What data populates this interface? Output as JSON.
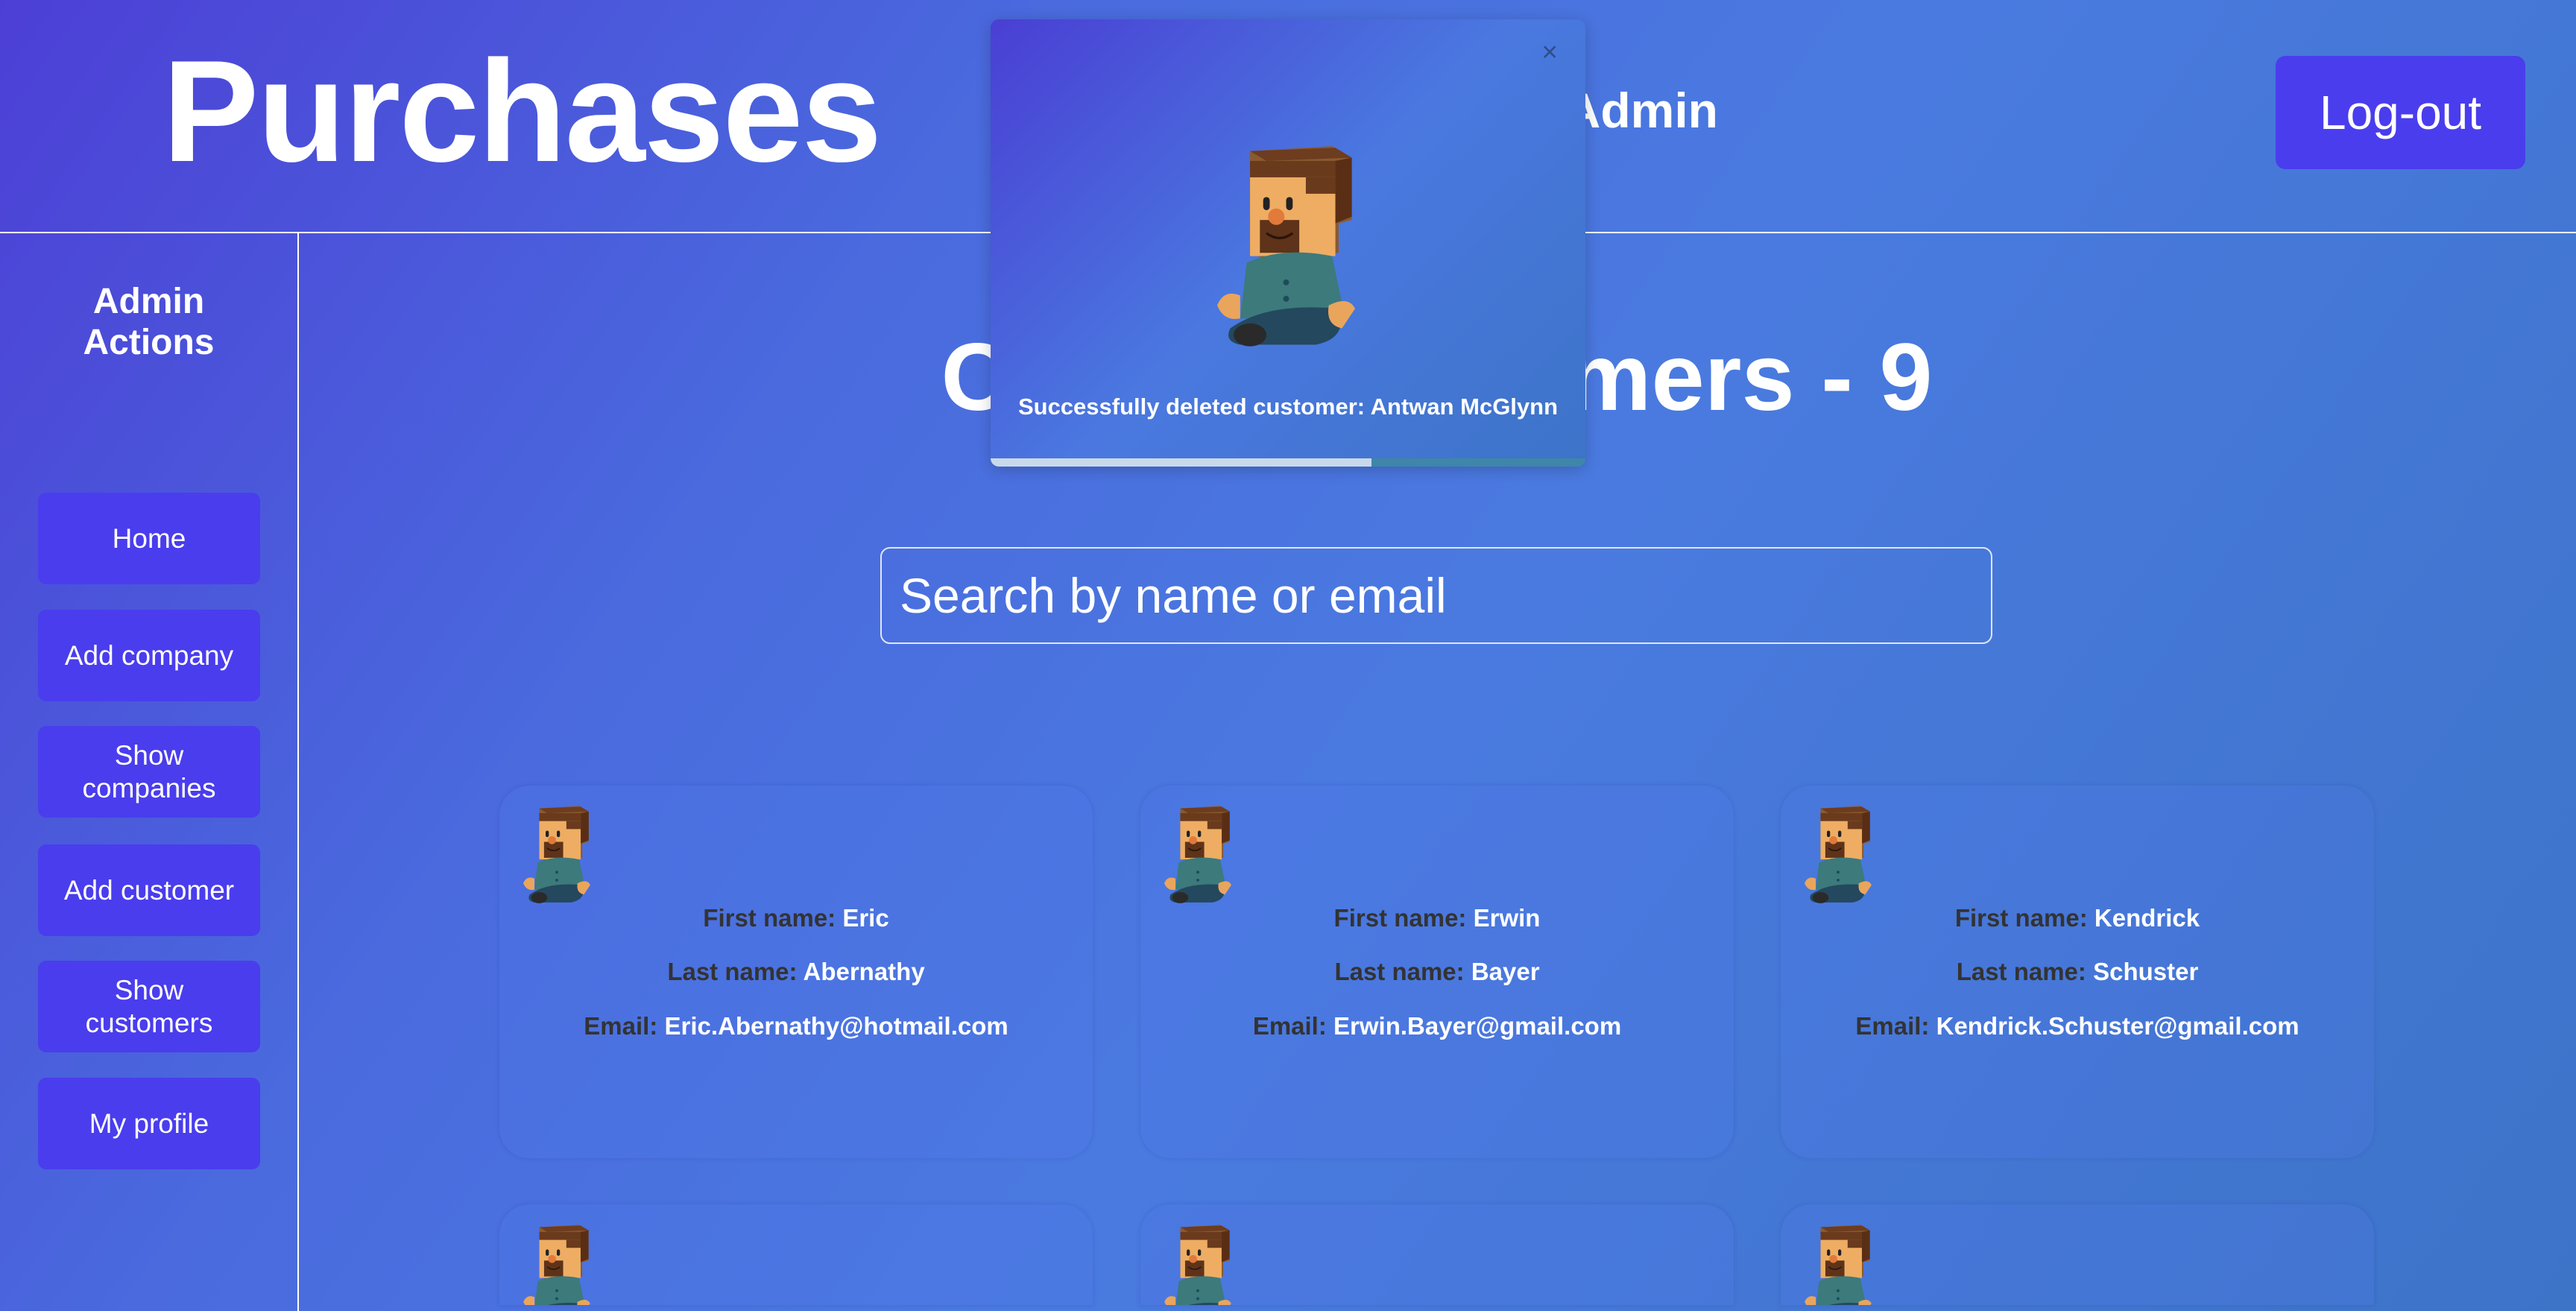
{
  "header": {
    "title": "Purchases",
    "greeting": "Admin",
    "logout_label": "Log-out"
  },
  "sidebar": {
    "title": "Admin Actions",
    "items": [
      {
        "label": "Home"
      },
      {
        "label": "Add company"
      },
      {
        "label": "Show companies"
      },
      {
        "label": "Add customer"
      },
      {
        "label": "Show customers"
      },
      {
        "label": "My profile"
      }
    ]
  },
  "main": {
    "heading": "Current customers - 9",
    "search": {
      "placeholder": "Search by name or email",
      "value": ""
    },
    "labels": {
      "first": "First name:",
      "last": "Last name:",
      "email": "Email:"
    },
    "customers": [
      {
        "first": "Eric",
        "last": "Abernathy",
        "email": "Eric.Abernathy@hotmail.com"
      },
      {
        "first": "Erwin",
        "last": "Bayer",
        "email": "Erwin.Bayer@gmail.com"
      },
      {
        "first": "Kendrick",
        "last": "Schuster",
        "email": "Kendrick.Schuster@gmail.com"
      }
    ]
  },
  "toast": {
    "message": "Successfully deleted customer: Antwan McGlynn",
    "close_icon": "×",
    "progress": 0.64
  }
}
